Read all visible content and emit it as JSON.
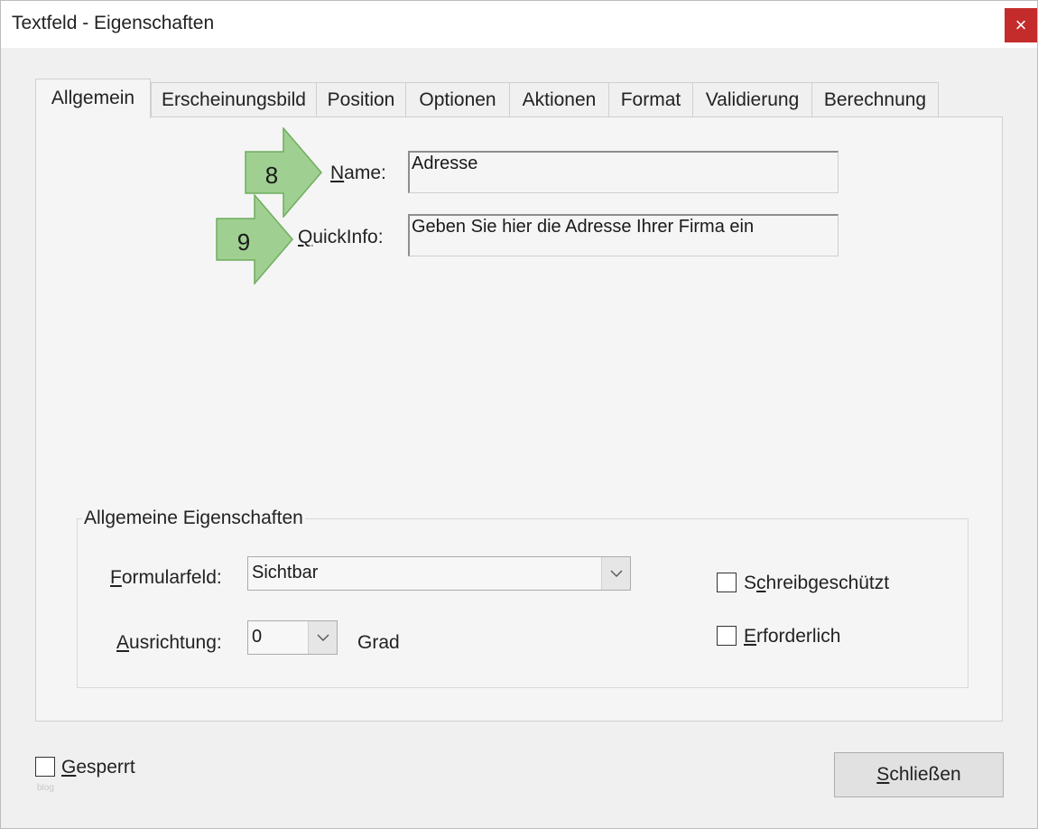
{
  "window": {
    "title": "Textfeld - Eigenschaften",
    "close_glyph": "×"
  },
  "tabs": [
    {
      "label": "Allgemein",
      "active": true
    },
    {
      "label": "Erscheinungsbild",
      "active": false
    },
    {
      "label": "Position",
      "active": false
    },
    {
      "label": "Optionen",
      "active": false
    },
    {
      "label": "Aktionen",
      "active": false
    },
    {
      "label": "Format",
      "active": false
    },
    {
      "label": "Validierung",
      "active": false
    },
    {
      "label": "Berechnung",
      "active": false
    }
  ],
  "general": {
    "name_label_mnemonic": "N",
    "name_label_rest": "ame:",
    "name_value": "Adresse",
    "quickinfo_label_mnemonic": "Q",
    "quickinfo_label_rest": "uickInfo:",
    "quickinfo_value": "Geben Sie hier die Adresse Ihrer Firma ein"
  },
  "annotations": {
    "arrow_1": "8",
    "arrow_2": "9",
    "arrow_color": "#9fcf91"
  },
  "properties": {
    "group_title": "Allgemeine Eigenschaften",
    "form_field_label_mnemonic": "F",
    "form_field_label_rest": "ormularfeld:",
    "form_field_value": "Sichtbar",
    "orientation_label_mnemonic": "A",
    "orientation_label_rest": "usrichtung:",
    "orientation_value": "0",
    "orientation_unit": "Grad",
    "readonly_label_pre": "S",
    "readonly_label_mnemonic": "c",
    "readonly_label_rest": "hreibgeschützt",
    "readonly_checked": false,
    "required_label_mnemonic": "E",
    "required_label_rest": "rforderlich",
    "required_checked": false
  },
  "footer": {
    "locked_label_mnemonic": "G",
    "locked_label_rest": "esperrt",
    "locked_checked": false,
    "close_button_mnemonic": "S",
    "close_button_rest": "chließen",
    "watermark": "blog"
  },
  "colors": {
    "close_button_bg": "#c42b2b",
    "panel_bg": "#f5f5f5",
    "window_bg": "#f0f0f0"
  }
}
